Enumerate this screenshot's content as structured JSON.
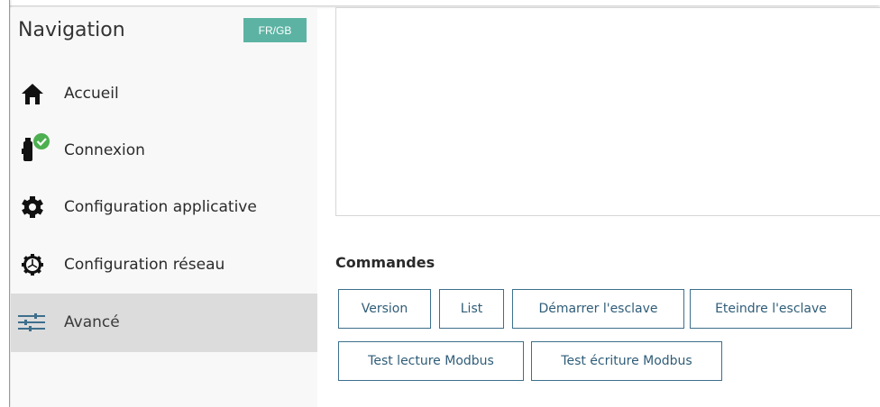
{
  "sidebar": {
    "title": "Navigation",
    "lang_button": "FR/GB",
    "items": [
      {
        "label": "Accueil",
        "icon": "home-icon"
      },
      {
        "label": "Connexion",
        "icon": "usb-connected-icon"
      },
      {
        "label": "Configuration applicative",
        "icon": "gear-icon"
      },
      {
        "label": "Configuration réseau",
        "icon": "network-gear-icon"
      },
      {
        "label": "Avancé",
        "icon": "sliders-icon",
        "active": true
      }
    ]
  },
  "commands": {
    "title": "Commandes",
    "buttons": [
      "Version",
      "List",
      "Démarrer l'esclave",
      "Eteindre l'esclave",
      "Test lecture Modbus",
      "Test écriture Modbus"
    ]
  },
  "colors": {
    "accent": "#5cb3a3",
    "button_border": "#3d6f8c",
    "active_item_bg": "#dcdcdc",
    "connected_badge": "#4caf50"
  }
}
